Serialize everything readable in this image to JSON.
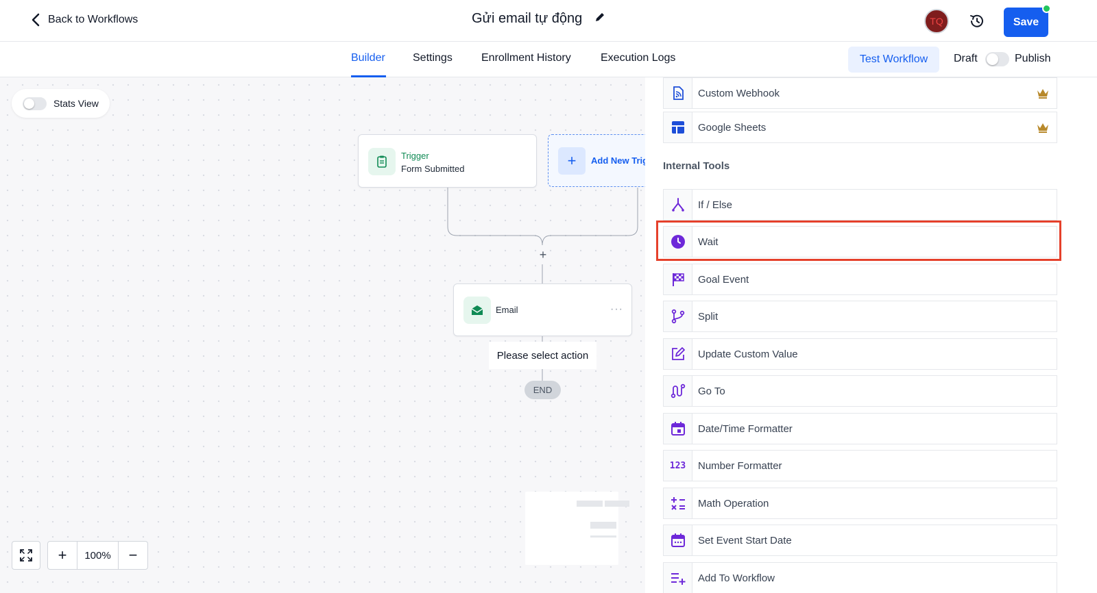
{
  "header": {
    "back_label": "Back to Workflows",
    "title": "Gửi email tự động",
    "avatar_initials": "TQ",
    "save_label": "Save",
    "status_dot_color": "#22c55e"
  },
  "tabs": {
    "builder": "Builder",
    "settings": "Settings",
    "enrollment": "Enrollment History",
    "logs": "Execution Logs",
    "active": "Builder"
  },
  "actions": {
    "test_label": "Test Workflow",
    "draft_label": "Draft",
    "publish_label": "Publish"
  },
  "canvas": {
    "stats_label": "Stats View",
    "trigger": {
      "title": "Trigger",
      "subtitle": "Form Submitted"
    },
    "add_trigger_label": "Add New Trigger",
    "add_step_symbol": "+",
    "email_label": "Email",
    "email_menu": "···",
    "select_action_label": "Please select action",
    "end_label": "END",
    "zoom_in": "+",
    "zoom_out": "−",
    "zoom_level": "100%"
  },
  "panel": {
    "top_items": [
      {
        "label": "Custom Webhook",
        "icon": "webhook-icon",
        "premium": true
      },
      {
        "label": "Google Sheets",
        "icon": "google-sheets-icon",
        "premium": true
      }
    ],
    "section_title": "Internal Tools",
    "items": [
      {
        "label": "If / Else",
        "icon": "branch-icon"
      },
      {
        "label": "Wait",
        "icon": "clock-icon",
        "highlighted": true
      },
      {
        "label": "Goal Event",
        "icon": "checkered-flag-icon"
      },
      {
        "label": "Split",
        "icon": "split-icon"
      },
      {
        "label": "Update Custom Value",
        "icon": "edit-icon"
      },
      {
        "label": "Go To",
        "icon": "goto-icon"
      },
      {
        "label": "Date/Time Formatter",
        "icon": "calendar-icon"
      },
      {
        "label": "Number Formatter",
        "icon": "number-icon"
      },
      {
        "label": "Math Operation",
        "icon": "math-icon"
      },
      {
        "label": "Set Event Start Date",
        "icon": "calendar-date-icon"
      },
      {
        "label": "Add To Workflow",
        "icon": "add-list-icon"
      }
    ],
    "number_icon_text": "123",
    "highlight_color": "#e5402b",
    "accent_color": "#6d28d9"
  }
}
